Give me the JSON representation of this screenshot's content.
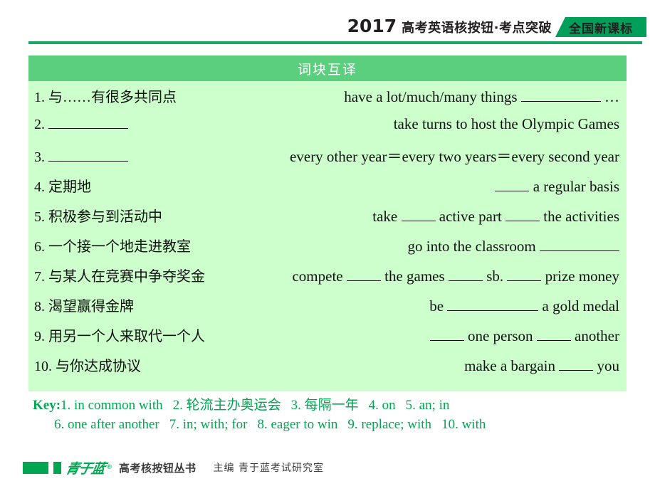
{
  "header": {
    "year": "2017",
    "subtitle": "高考英语核按钮·考点突破",
    "tag": "全国新课标",
    "accent_color": "#00a05a",
    "rule_color": "#17a866"
  },
  "table": {
    "title": "词块互译",
    "header_bg": "#5ccf7f",
    "body_bg": "#ccffcc",
    "rows": [
      {
        "num": "1.",
        "cn": "与……有很多共同点",
        "en_before": "have a lot/much/many things",
        "blank": "b-l",
        "en_after": "…"
      },
      {
        "num": "2.",
        "cn": "",
        "en_before": "take turns to host the Olympic Games",
        "blank": "",
        "en_after": "",
        "cn_blank": "b-l"
      },
      {
        "num": "3.",
        "cn": "",
        "en_before": "every other year＝every two years＝every second year",
        "blank": "",
        "en_after": "",
        "cn_blank": "b-l"
      },
      {
        "num": "4.",
        "cn": "定期地",
        "en_before": "",
        "blank": "b-m",
        "en_after": "a regular basis"
      },
      {
        "num": "5.",
        "cn": "积极参与到活动中",
        "en_before": "take",
        "blank": "b-m",
        "en_mid": "active part",
        "blank2": "b-m",
        "en_after": "the activities"
      },
      {
        "num": "6.",
        "cn": "一个接一个地走进教室",
        "en_before": "go into the classroom",
        "blank": "b-l",
        "en_after": ""
      },
      {
        "num": "7.",
        "cn": "与某人在竞赛中争夺奖金",
        "en_before": "compete",
        "blank": "b-m",
        "en_mid": "the games",
        "blank2": "b-m",
        "en_mid2": "sb.",
        "blank3": "b-m",
        "en_after": "prize money"
      },
      {
        "num": "8.",
        "cn": "渴望赢得金牌",
        "en_before": "be",
        "blank": "b-xl",
        "en_after": "a gold medal"
      },
      {
        "num": "9.",
        "cn": "用另一个人来取代一个人",
        "en_before": "",
        "blank": "b-m",
        "en_mid": "one person",
        "blank2": "b-m",
        "en_after": "another"
      },
      {
        "num": "10.",
        "cn": "与你达成协议",
        "en_before": "make a bargain",
        "blank": "b-m",
        "en_after": "you"
      }
    ]
  },
  "key": {
    "label": "Key:",
    "color": "#00a651",
    "line1": [
      "1. in common with",
      "2. 轮流主办奥运会",
      "3. 每隔一年",
      "4. on",
      "5. an; in"
    ],
    "line2": [
      "6. one after another",
      "7. in; with; for",
      "8. eager to win",
      "9. replace; with",
      "10. with"
    ]
  },
  "footer": {
    "logo_text": "青于蓝",
    "registered_mark": "®",
    "series": "高考核按钮丛书",
    "editor": "主编 青于蓝考试研究室"
  }
}
